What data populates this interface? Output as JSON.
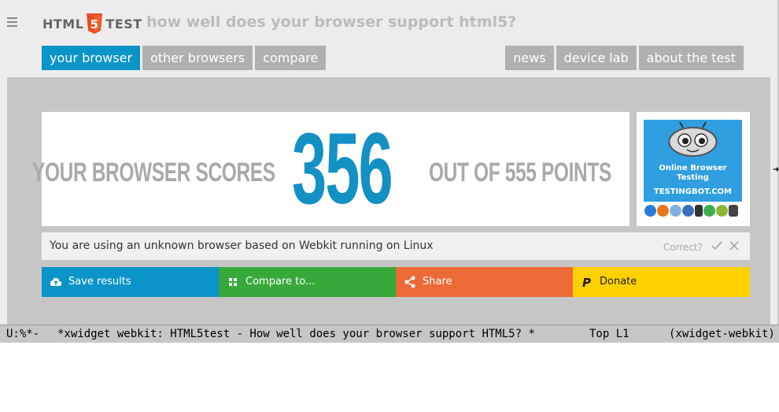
{
  "header": {
    "logo_left": "HTML",
    "logo_right": "TEST",
    "tagline": "how well does your browser support html5?"
  },
  "nav_left": [
    "your browser",
    "other browsers",
    "compare"
  ],
  "nav_right": [
    "news",
    "device lab",
    "about the test"
  ],
  "score": {
    "prefix": "YOUR BROWSER SCORES",
    "value": "356",
    "suffix": "OUT OF 555 POINTS"
  },
  "ad": {
    "line1": "Online Browser",
    "line2": "Testing",
    "domain": "TESTINGBOT.COM"
  },
  "browser_info": {
    "text": "You are using an unknown browser based on Webkit running on Linux",
    "correct_label": "Correct?"
  },
  "actions": [
    {
      "label": "Save results",
      "icon": "cloud-upload-icon",
      "color": "#0b94c8"
    },
    {
      "label": "Compare to...",
      "icon": "grid-icon",
      "color": "#36a93a"
    },
    {
      "label": "Share",
      "icon": "share-icon",
      "color": "#ec6a37"
    },
    {
      "label": "Donate",
      "icon": "paypal-icon",
      "color": "#fdd100"
    }
  ],
  "modeline": {
    "status": "U:%*-",
    "buffer": "*xwidget webkit: HTML5test - How well does your browser support HTML5? *",
    "position": "Top L1",
    "mode": "(xwidget-webkit)"
  },
  "colors": {
    "accent": "#0b94c8",
    "tab_inactive": "#b0b0b0",
    "score_number": "#1390c4"
  }
}
